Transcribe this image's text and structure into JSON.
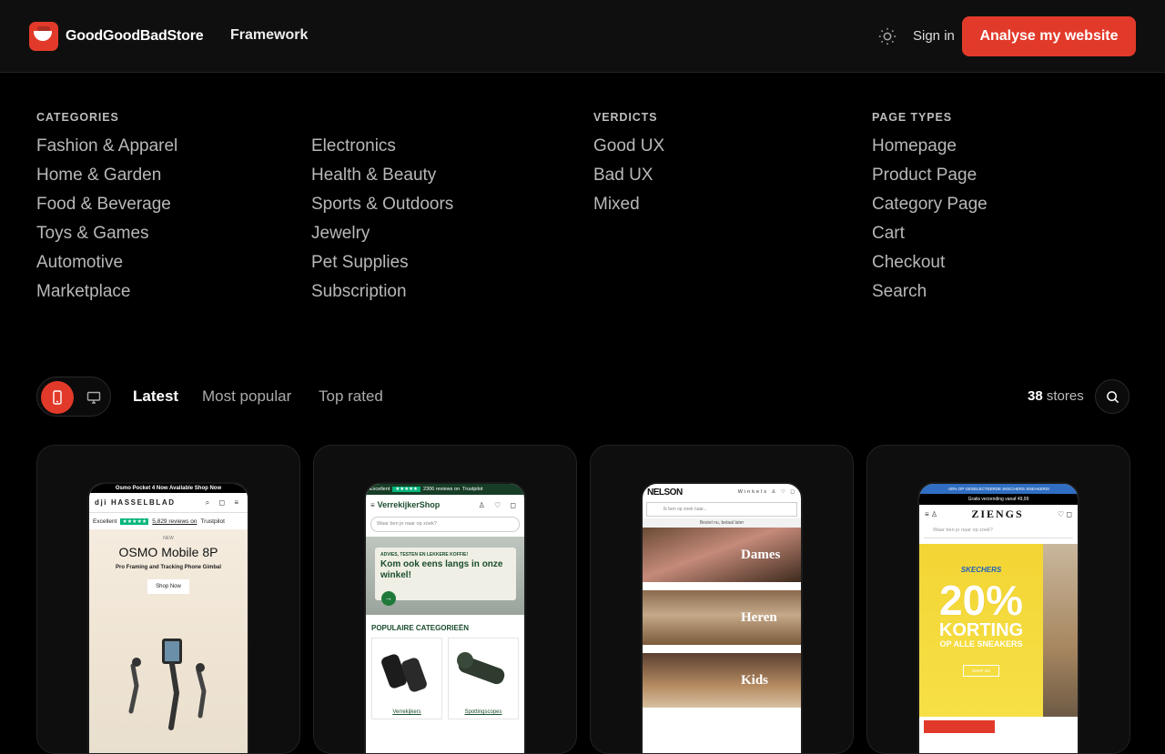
{
  "header": {
    "brand": "GoodGoodBadStore",
    "nav_framework": "Framework",
    "sign_in": "Sign in",
    "cta": "Analyse my website"
  },
  "menu": {
    "categories_heading": "CATEGORIES",
    "categories_col1": [
      "Fashion & Apparel",
      "Home & Garden",
      "Food & Beverage",
      "Toys & Games",
      "Automotive",
      "Marketplace"
    ],
    "categories_col2": [
      "Electronics",
      "Health & Beauty",
      "Sports & Outdoors",
      "Jewelry",
      "Pet Supplies",
      "Subscription"
    ],
    "verdicts_heading": "VERDICTS",
    "verdicts": [
      "Good UX",
      "Bad UX",
      "Mixed"
    ],
    "page_types_heading": "PAGE TYPES",
    "page_types": [
      "Homepage",
      "Product Page",
      "Category Page",
      "Cart",
      "Checkout",
      "Search"
    ]
  },
  "toolbar": {
    "tabs": [
      "Latest",
      "Most popular",
      "Top rated"
    ],
    "active_tab": "Latest",
    "count": "38",
    "count_suffix": "stores"
  },
  "cards": [
    {
      "topbar": "Osmo Pocket 4 Now Available Shop Now",
      "logo": "dji HASSELBLAD",
      "trust_excellent": "Excellent",
      "trust_reviews": "5,829 reviews on",
      "trust_brand": "Trustpilot",
      "hero_new": "NEW",
      "hero_title": "OSMO Mobile 8P",
      "hero_sub": "Pro Framing and Tracking Phone Gimbal",
      "hero_btn": "Shop Now"
    },
    {
      "trust_excellent": "Excellent",
      "trust_reviews": "2306 reviews on",
      "trust_brand": "Trustpilot",
      "logo": "VerrekijkerShop",
      "search_placeholder": "Waar ben je naar op zoek?",
      "bubble_small": "ADVIES, TESTEN EN LEKKERE KOFFIE!",
      "bubble_big": "Kom ook eens langs in onze winkel!",
      "section_title": "POPULAIRE CATEGORIEËN",
      "tiles": [
        "Verrekijkers",
        "Spottingscopes"
      ]
    },
    {
      "logo": "NELSON",
      "store_link": "Winkels",
      "search_placeholder": "Ik ben op zoek naar...",
      "note": "Bestel nu, betaal later",
      "panels": [
        "Dames",
        "Heren",
        "Kids"
      ]
    },
    {
      "promo": "-20% OP GESELECTEERDE SKECHERS SNEAKERS!",
      "shipping": "Gratis verzending vanaf 49,99",
      "logo": "ZIENGS",
      "search_placeholder": "Waar ben je naar op zoek?",
      "banner_brand": "SKECHERS",
      "banner_pct": "20%",
      "banner_korting": "KORTING",
      "banner_line": "OP ALLE SNEAKERS",
      "banner_btn": "SHOP NU"
    }
  ],
  "colors": {
    "accent": "#e23a2a",
    "background": "#000000",
    "header": "#0f0f0f"
  }
}
